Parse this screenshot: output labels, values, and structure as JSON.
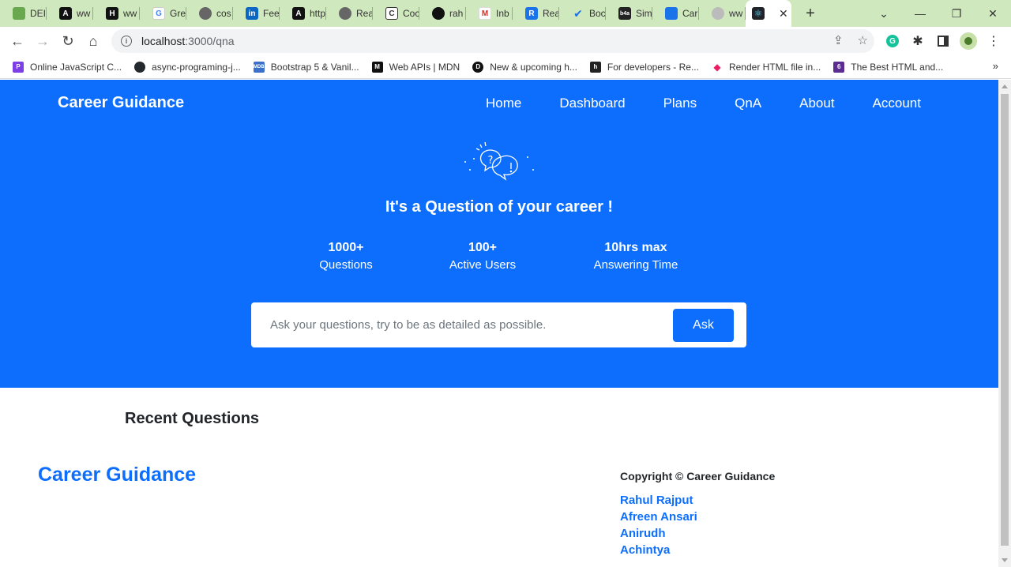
{
  "browser": {
    "tabs": [
      {
        "label": "DEI",
        "color": "#6aa84f"
      },
      {
        "label": "ww",
        "color": "#111111"
      },
      {
        "label": "ww",
        "color": "#111111"
      },
      {
        "label": "Gre",
        "color": "#4285f4"
      },
      {
        "label": "cos",
        "color": "#666666"
      },
      {
        "label": "Fee",
        "color": "#0a66c2"
      },
      {
        "label": "http",
        "color": "#111111"
      },
      {
        "label": "Rea",
        "color": "#666666"
      },
      {
        "label": "Coc",
        "color": "#333333"
      },
      {
        "label": "rah",
        "color": "#111111"
      },
      {
        "label": "Inb",
        "color": "#d93025"
      },
      {
        "label": "Rea",
        "color": "#1a73e8"
      },
      {
        "label": "Boc",
        "color": "#1a73e8"
      },
      {
        "label": "Sim",
        "color": "#222222"
      },
      {
        "label": "Car",
        "color": "#1a73e8"
      },
      {
        "label": "ww",
        "color": "#777777"
      }
    ],
    "url_host": "localhost",
    "url_path": ":3000/qna",
    "bookmarks": [
      {
        "label": "Online JavaScript C...",
        "color": "#7b3fe4"
      },
      {
        "label": "async-programing-j...",
        "color": "#24292e"
      },
      {
        "label": "Bootstrap 5 & Vanil...",
        "color": "#3b71ca"
      },
      {
        "label": "Web APIs | MDN",
        "color": "#111111"
      },
      {
        "label": "New & upcoming h...",
        "color": "#111111"
      },
      {
        "label": "For developers - Re...",
        "color": "#222222"
      },
      {
        "label": "Render HTML file in...",
        "color": "#e91e63"
      },
      {
        "label": "The Best HTML and...",
        "color": "#5c2d91"
      }
    ]
  },
  "header": {
    "brand": "Career Guidance",
    "nav": [
      "Home",
      "Dashboard",
      "Plans",
      "QnA",
      "About",
      "Account"
    ]
  },
  "hero": {
    "title": "It's a Question of your career !",
    "stats": [
      {
        "value": "1000+",
        "label": "Questions"
      },
      {
        "value": "100+",
        "label": "Active Users"
      },
      {
        "value": "10hrs max",
        "label": "Answering Time"
      }
    ],
    "ask": {
      "placeholder": "Ask your questions, try to be as detailed as possible.",
      "button": "Ask"
    }
  },
  "recent": {
    "title": "Recent Questions"
  },
  "footer": {
    "brand": "Career Guidance",
    "copyright": "Copyright © Career Guidance",
    "members": [
      "Rahul Rajput",
      "Afreen Ansari",
      "Anirudh",
      "Achintya"
    ]
  },
  "colors": {
    "primary": "#0d6efd",
    "tabbar": "#cfe8bd"
  }
}
